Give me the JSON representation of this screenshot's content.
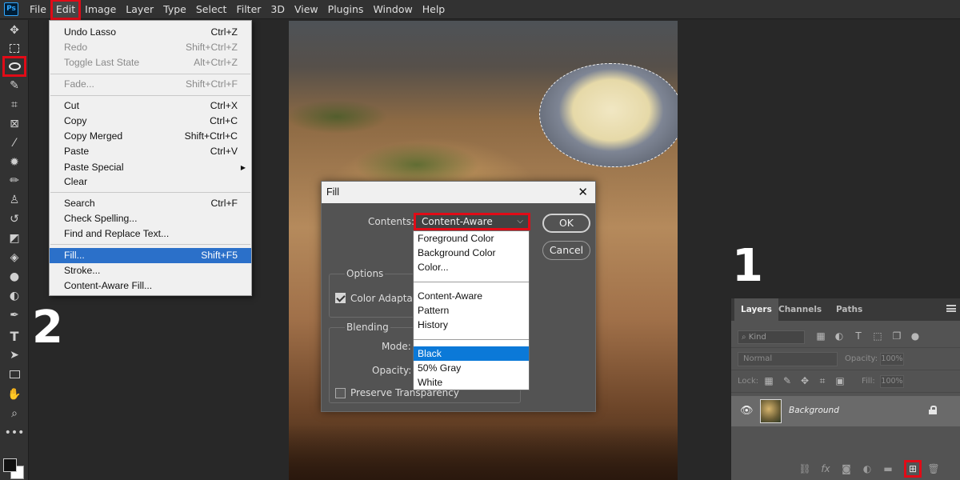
{
  "app": {
    "logo": "Ps"
  },
  "menubar": [
    "File",
    "Edit",
    "Image",
    "Layer",
    "Type",
    "Select",
    "Filter",
    "3D",
    "View",
    "Plugins",
    "Window",
    "Help"
  ],
  "toolbar": {
    "icons": [
      "move-icon",
      "marquee-icon",
      "lasso-icon",
      "quick-select-icon",
      "crop-icon",
      "frame-icon",
      "eyedropper-icon",
      "spot-heal-icon",
      "brush-icon",
      "clone-stamp-icon",
      "history-brush-icon",
      "eraser-icon",
      "paint-bucket-icon",
      "blur-icon",
      "dodge-icon",
      "pen-icon",
      "type-icon",
      "path-select-icon",
      "rectangle-icon",
      "hand-icon",
      "zoom-icon",
      "more-icon"
    ],
    "type_glyph": "T"
  },
  "annotations": {
    "one": "1",
    "two": "2"
  },
  "edit_menu": {
    "items": [
      {
        "label": "Undo Lasso",
        "shortcut": "Ctrl+Z",
        "state": "normal"
      },
      {
        "label": "Redo",
        "shortcut": "Shift+Ctrl+Z",
        "state": "disabled"
      },
      {
        "label": "Toggle Last State",
        "shortcut": "Alt+Ctrl+Z",
        "state": "disabled"
      },
      {
        "label": "Fade...",
        "shortcut": "Shift+Ctrl+F",
        "state": "disabled"
      },
      {
        "label": "Cut",
        "shortcut": "Ctrl+X",
        "state": "normal"
      },
      {
        "label": "Copy",
        "shortcut": "Ctrl+C",
        "state": "normal"
      },
      {
        "label": "Copy Merged",
        "shortcut": "Shift+Ctrl+C",
        "state": "normal"
      },
      {
        "label": "Paste",
        "shortcut": "Ctrl+V",
        "state": "normal"
      },
      {
        "label": "Paste Special",
        "shortcut": "",
        "state": "submenu"
      },
      {
        "label": "Clear",
        "shortcut": "",
        "state": "normal"
      },
      {
        "label": "Search",
        "shortcut": "Ctrl+F",
        "state": "normal"
      },
      {
        "label": "Check Spelling...",
        "shortcut": "",
        "state": "normal"
      },
      {
        "label": "Find and Replace Text...",
        "shortcut": "",
        "state": "normal"
      },
      {
        "label": "Fill...",
        "shortcut": "Shift+F5",
        "state": "active"
      },
      {
        "label": "Stroke...",
        "shortcut": "",
        "state": "normal"
      },
      {
        "label": "Content-Aware Fill...",
        "shortcut": "",
        "state": "normal"
      }
    ]
  },
  "fill_dialog": {
    "title": "Fill",
    "close": "✕",
    "contents_label": "Contents:",
    "contents_value": "Content-Aware",
    "ok_label": "OK",
    "cancel_label": "Cancel",
    "options_label": "Options",
    "color_adaptation_label": "Color Adaptation",
    "blending_label": "Blending",
    "mode_label": "Mode:",
    "opacity_label": "Opacity:",
    "preserve_transparency_label": "Preserve Transparency",
    "contents_options": [
      [
        "Foreground Color",
        "Background Color",
        "Color..."
      ],
      [
        "Content-Aware",
        "Pattern",
        "History"
      ],
      [
        "Black",
        "50% Gray",
        "White"
      ]
    ],
    "highlighted_option": "Black"
  },
  "layers_panel": {
    "tabs": [
      "Layers",
      "Channels",
      "Paths"
    ],
    "kind_label": "Kind",
    "blend_mode": "Normal",
    "opacity_label": "Opacity:",
    "opacity_value": "100%",
    "lock_label": "Lock:",
    "fill_label": "Fill:",
    "fill_value": "100%",
    "layer_name": "Background",
    "bottom_icons": [
      "link-icon",
      "fx-icon",
      "mask-icon",
      "adjustment-icon",
      "group-folder-icon",
      "new-layer-icon",
      "trash-icon"
    ]
  }
}
